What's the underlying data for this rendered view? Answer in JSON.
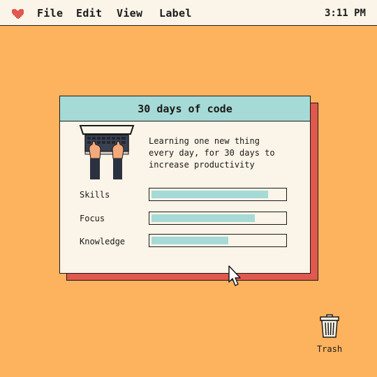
{
  "menubar": {
    "icon": "heart-icon",
    "items": [
      {
        "label": "File"
      },
      {
        "label": "Edit"
      },
      {
        "label": "View"
      },
      {
        "label": "Label"
      }
    ],
    "clock": "3:11 PM"
  },
  "window": {
    "title": "30 days of code",
    "illustration": "laptop-typing-icon",
    "description": "Learning one new thing\nevery day, for 30 days to\nincrease productivity",
    "stats": [
      {
        "label": "Skills",
        "progress": 0.88
      },
      {
        "label": "Focus",
        "progress": 0.78
      },
      {
        "label": "Knowledge",
        "progress": 0.58
      }
    ]
  },
  "desktop": {
    "trash_label": "Trash",
    "trash_icon": "trash-icon",
    "cursor": "arrow-cursor-icon"
  },
  "colors": {
    "background": "#fdb25e",
    "menubar": "#fbf4e8",
    "heart": "#e0584e",
    "titlebar": "#a6dad6",
    "window_shadow": "#e0584e",
    "bar_fill": "#a6dad6"
  }
}
